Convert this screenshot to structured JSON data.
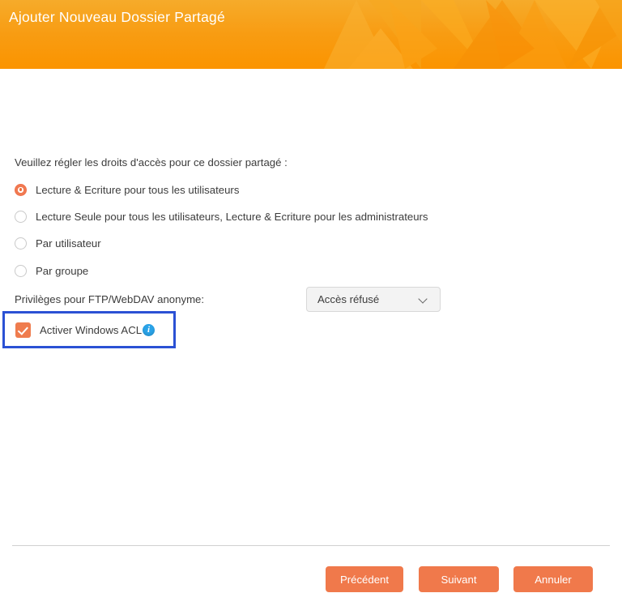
{
  "header": {
    "title": "Ajouter Nouveau Dossier Partagé",
    "gradient_start": "#f5a623",
    "gradient_end": "#fb9500"
  },
  "main": {
    "instruction": "Veuillez régler les droits d'accès pour ce dossier partagé :",
    "permission_options": [
      {
        "label": "Lecture & Ecriture pour tous les utilisateurs",
        "selected": true
      },
      {
        "label": "Lecture Seule pour tous les utilisateurs, Lecture & Ecriture pour les administrateurs",
        "selected": false
      },
      {
        "label": "Par utilisateur",
        "selected": false
      },
      {
        "label": "Par groupe",
        "selected": false
      }
    ],
    "privileges": {
      "label": "Privilèges pour FTP/WebDAV anonyme:",
      "selected_value": "Accès réfusé",
      "chevron_icon": "chevron-down-icon"
    },
    "windows_acl": {
      "label": "Activer Windows ACL",
      "checked": true,
      "info_icon": "info-icon",
      "info_glyph": "i",
      "highlight_color": "#2b51d4"
    }
  },
  "footer": {
    "buttons": [
      {
        "label": "Précédent",
        "name": "previous-button"
      },
      {
        "label": "Suivant",
        "name": "next-button"
      },
      {
        "label": "Annuler",
        "name": "cancel-button"
      }
    ],
    "button_color": "#f0794b"
  }
}
